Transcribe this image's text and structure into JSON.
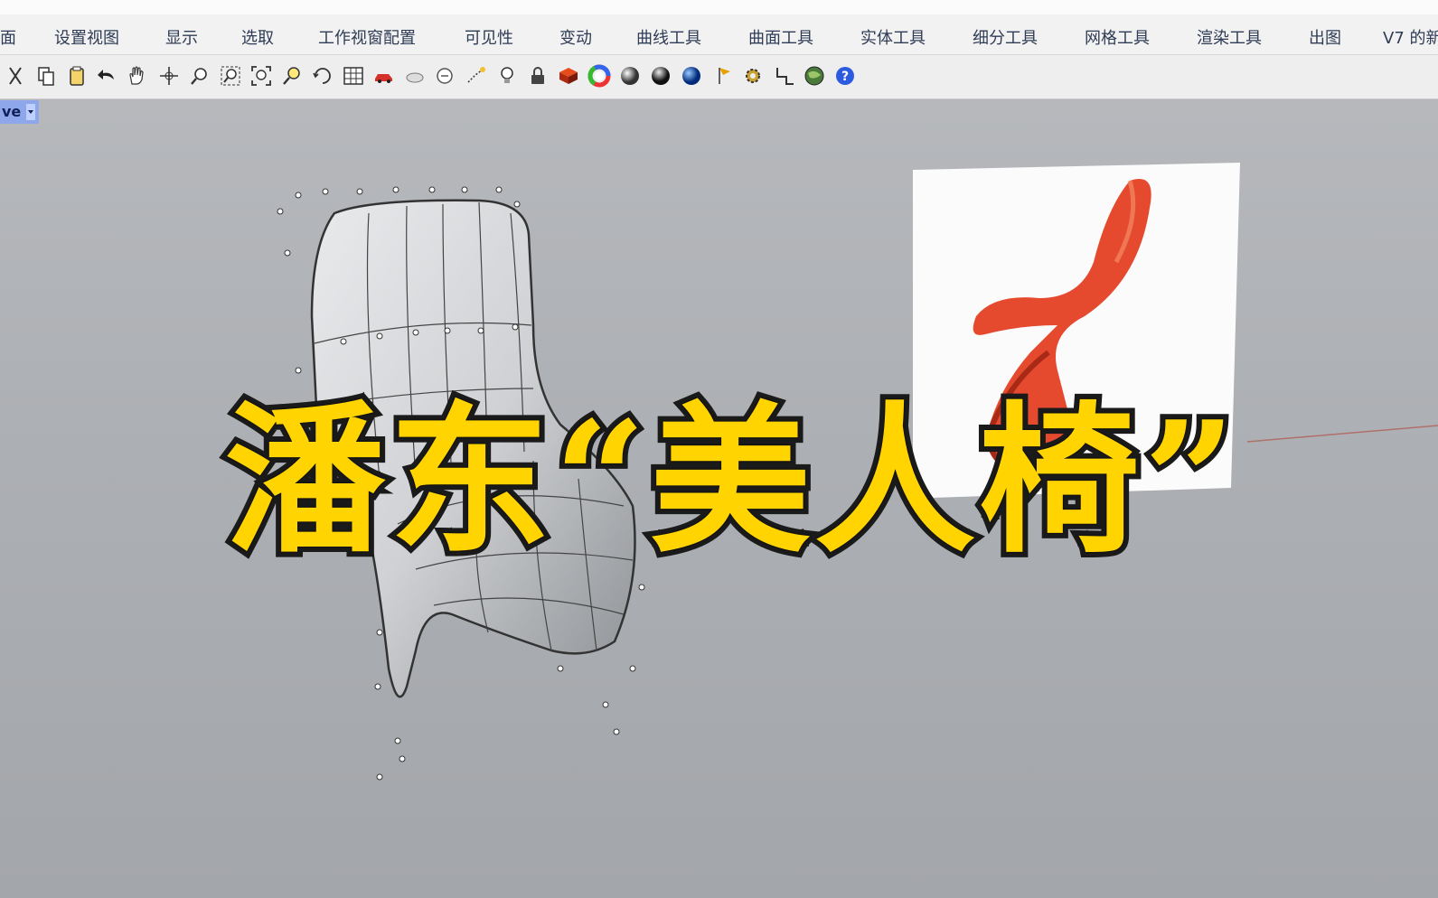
{
  "menu_tabs": [
    "面",
    "设置视图",
    "显示",
    "选取",
    "工作视窗配置",
    "可见性",
    "变动",
    "曲线工具",
    "曲面工具",
    "实体工具",
    "细分工具",
    "网格工具",
    "渲染工具",
    "出图",
    "V7 的新"
  ],
  "toolbar_icons": [
    "cut-icon",
    "copy-icon",
    "paste-icon",
    "undo-icon",
    "pan-hand-icon",
    "rotate-view-icon",
    "zoom-icon",
    "zoom-window-icon",
    "zoom-extents-icon",
    "zoom-selected-icon",
    "rotate-camera-icon",
    "grid-icon",
    "car-icon",
    "hidden-icon",
    "options-icon",
    "snap-icon",
    "light-bulb-icon",
    "lock-icon",
    "material-icon",
    "color-wheel-icon",
    "sphere-gray-icon",
    "sphere-shaded-icon",
    "sphere-blue-icon",
    "flag-icon",
    "gear-icon",
    "cplane-icon",
    "globe-icon",
    "help-icon"
  ],
  "viewport": {
    "label": "ve"
  },
  "caption": "潘东“美人椅”",
  "colors": {
    "caption_fill": "#ffd400",
    "caption_stroke": "#1a1a1a",
    "chair_red": "#e64a2e",
    "viewport_bg": "#abaeb2"
  }
}
